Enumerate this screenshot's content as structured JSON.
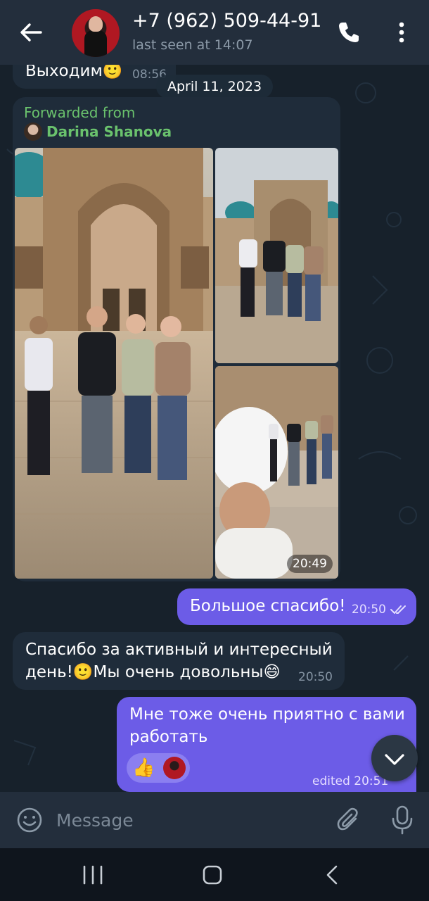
{
  "header": {
    "contact_name": "+7 (962) 509-44-91",
    "last_seen": "last seen at 14:07",
    "back_icon": "arrow-left-icon",
    "call_icon": "phone-icon",
    "menu_icon": "more-vertical-icon"
  },
  "chat": {
    "date_chip": "April 11, 2023",
    "messages": [
      {
        "direction": "in",
        "text": "Выходим🙂",
        "time": "08:56"
      },
      {
        "direction": "in",
        "forwarded_label": "Forwarded from",
        "forwarded_name": "Darina Shanova",
        "time": "20:49",
        "media": "photo-album"
      },
      {
        "direction": "out",
        "text": "Большое спасибо!",
        "time": "20:50",
        "status": "read"
      },
      {
        "direction": "in",
        "text_line1": "Спасибо за активный и интересный",
        "text_line2": "день!🙂Мы очень довольны😄",
        "time": "20:50"
      },
      {
        "direction": "out",
        "text_line1": "Мне тоже очень приятно с вами",
        "text_line2": "работать",
        "reaction": "👍",
        "time": "edited 20:51"
      }
    ]
  },
  "input": {
    "placeholder": "Message",
    "emoji_icon": "smile-icon",
    "attach_icon": "paperclip-icon",
    "mic_icon": "microphone-icon"
  },
  "colors": {
    "header_bg": "#232e3c",
    "chat_bg": "#17212b",
    "incoming_bubble": "#1f2c3a",
    "outgoing_bubble": "#6c5ce7",
    "forward_green": "#6ac26d"
  }
}
